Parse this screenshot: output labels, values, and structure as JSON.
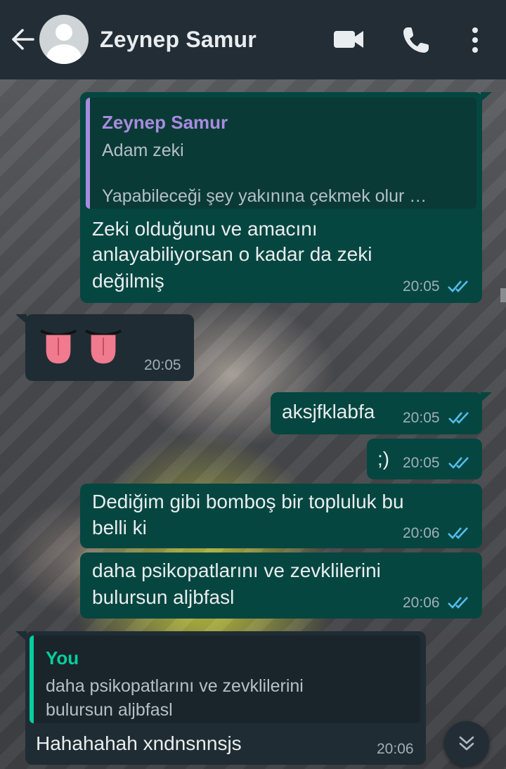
{
  "header": {
    "contact_name": "Zeynep Samur",
    "icons": [
      "back-arrow-icon",
      "avatar",
      "video-call-icon",
      "phone-call-icon",
      "more-options-icon"
    ]
  },
  "messages": [
    {
      "direction": "outgoing",
      "quote": {
        "author": "Zeynep Samur",
        "line1": "Adam zeki",
        "line2": "Yapabileceği şey yakınına çekmek olur …"
      },
      "lines": [
        "Zeki olduğunu ve amacını",
        "anlayabiliyorsan o kadar da zeki",
        "değilmiş"
      ],
      "time": "20:05",
      "status": "read"
    },
    {
      "direction": "incoming",
      "emoji": "😛😛",
      "time": "20:05"
    },
    {
      "direction": "outgoing",
      "lines": [
        "aksjfklabfa"
      ],
      "time": "20:05",
      "status": "read"
    },
    {
      "direction": "outgoing",
      "lines": [
        ";)"
      ],
      "time": "20:05",
      "status": "read"
    },
    {
      "direction": "outgoing",
      "lines": [
        "Dediğim gibi bomboş bir topluluk bu",
        "belli ki"
      ],
      "time": "20:06",
      "status": "read"
    },
    {
      "direction": "outgoing",
      "lines": [
        "daha psikopatlarını ve zevklilerini",
        "bulursun aljbfasl"
      ],
      "time": "20:06",
      "status": "read"
    },
    {
      "direction": "incoming",
      "quote": {
        "author": "You",
        "line1": "daha psikopatlarını ve zevklilerini",
        "line2": "bulursun aljbfasl"
      },
      "lines": [
        "Hahahahah xndnsnnsjs"
      ],
      "time": "20:06"
    }
  ],
  "colors": {
    "header_bg": "#232d36",
    "outgoing_bubble": "#054640",
    "incoming_bubble": "#1f2c33",
    "read_ticks": "#53bdeb",
    "quote_author_contact": "#a88be0",
    "quote_author_you": "#06cf9c"
  }
}
